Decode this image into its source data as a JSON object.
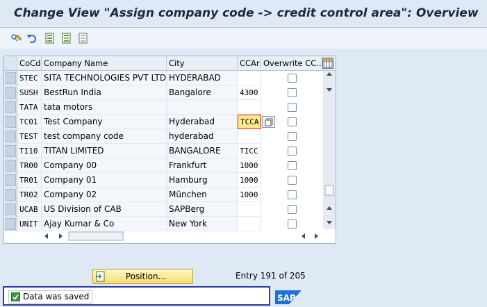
{
  "title": "Change View \"Assign company code -> credit control area\": Overview",
  "toolbar": {
    "icons": [
      "display-change-icon",
      "undo-icon",
      "select-all-icon",
      "select-block-icon",
      "deselect-all-icon"
    ]
  },
  "table": {
    "columns": [
      "CoCd",
      "Company Name",
      "City",
      "CCAr",
      "Overwrite CC..."
    ],
    "rows": [
      {
        "cocd": "STEC",
        "name": "SITA TECHNOLOGIES PVT LTD",
        "city": "HYDERABAD",
        "ccar": "",
        "overwrite": false
      },
      {
        "cocd": "SUSH",
        "name": "BestRun India",
        "city": "Bangalore",
        "ccar": "4300",
        "overwrite": false
      },
      {
        "cocd": "TATA",
        "name": "tata motors",
        "city": "",
        "ccar": "",
        "overwrite": false
      },
      {
        "cocd": "TC01",
        "name": "Test Company",
        "city": "Hyderabad",
        "ccar": "TCCA",
        "overwrite": false
      },
      {
        "cocd": "TEST",
        "name": "test company code",
        "city": "hyderabad",
        "ccar": "",
        "overwrite": false
      },
      {
        "cocd": "TI10",
        "name": "TITAN LIMITED",
        "city": "BANGALORE",
        "ccar": "TICC",
        "overwrite": false
      },
      {
        "cocd": "TR00",
        "name": "Company 00",
        "city": "Frankfurt",
        "ccar": "1000",
        "overwrite": false
      },
      {
        "cocd": "TR01",
        "name": "Company 01",
        "city": "Hamburg",
        "ccar": "1000",
        "overwrite": false
      },
      {
        "cocd": "TR02",
        "name": "Company 02",
        "city": "München",
        "ccar": "1000",
        "overwrite": false
      },
      {
        "cocd": "UCAB",
        "name": "US Division of CAB",
        "city": "SAPBerg",
        "ccar": "",
        "overwrite": false
      },
      {
        "cocd": "UNIT",
        "name": "Ajay Kumar & Co",
        "city": "New York",
        "ccar": "",
        "overwrite": false
      }
    ]
  },
  "position_button": {
    "label": "Position..."
  },
  "entry_info": "Entry 191 of 205",
  "status": {
    "message": "Data was saved"
  },
  "colors": {
    "accent": "#2b3a9e",
    "button": "#f7dd72",
    "focus": "#ffe98a"
  }
}
